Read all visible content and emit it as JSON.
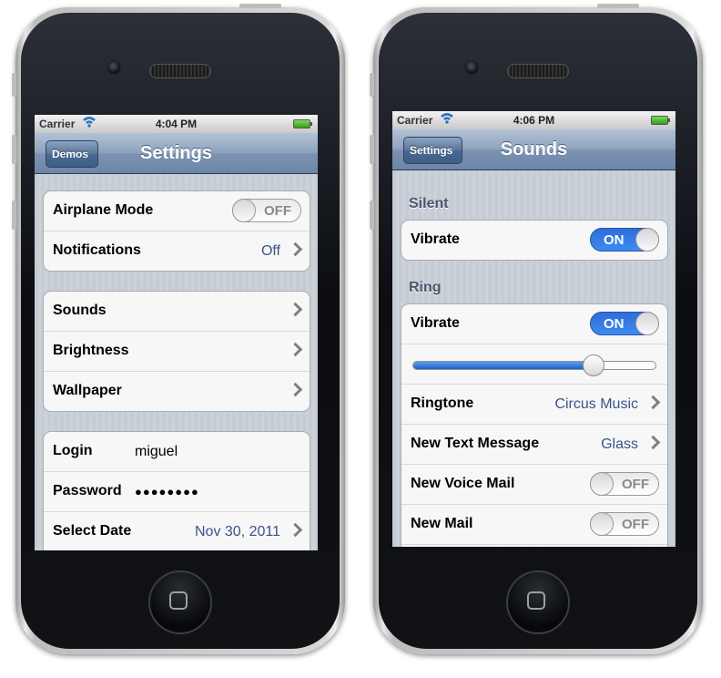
{
  "left_phone": {
    "status_bar": {
      "carrier": "Carrier",
      "time": "4:04 PM",
      "wifi_icon": "wifi-icon",
      "battery_icon": "battery-icon"
    },
    "nav": {
      "back_label": "Demos",
      "title": "Settings"
    },
    "airplane": {
      "label": "Airplane Mode",
      "toggle": "OFF"
    },
    "notifications": {
      "label": "Notifications",
      "value": "Off"
    },
    "sounds": {
      "label": "Sounds"
    },
    "brightness": {
      "label": "Brightness"
    },
    "wallpaper": {
      "label": "Wallpaper"
    },
    "login": {
      "label": "Login",
      "value": "miguel"
    },
    "password": {
      "label": "Password",
      "value": "●●●●●●●●"
    },
    "select_date": {
      "label": "Select Date",
      "value": "Nov 30, 2011"
    }
  },
  "right_phone": {
    "status_bar": {
      "carrier": "Carrier",
      "time": "4:06 PM",
      "wifi_icon": "wifi-icon",
      "battery_icon": "battery-icon"
    },
    "nav": {
      "back_label": "Settings",
      "title": "Sounds"
    },
    "silent_header": "Silent",
    "silent_vibrate": {
      "label": "Vibrate",
      "toggle": "ON"
    },
    "ring_header": "Ring",
    "ring_vibrate": {
      "label": "Vibrate",
      "toggle": "ON"
    },
    "volume_level": 0.74,
    "ringtone": {
      "label": "Ringtone",
      "value": "Circus Music"
    },
    "new_text_message": {
      "label": "New Text Message",
      "value": "Glass"
    },
    "new_voice_mail": {
      "label": "New Voice Mail",
      "toggle": "OFF"
    },
    "new_mail": {
      "label": "New Mail",
      "toggle": "OFF"
    }
  },
  "colors": {
    "nav_bar": "#6d86a8",
    "toggle_on": "#3d8bf0",
    "value_text": "#385487"
  }
}
